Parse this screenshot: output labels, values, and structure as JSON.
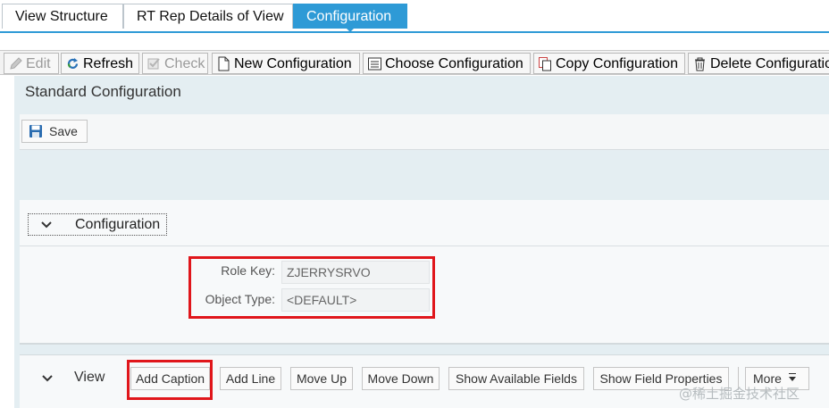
{
  "tabs": [
    {
      "label": "View Structure",
      "active": false
    },
    {
      "label": "RT Rep Details of View",
      "active": false
    },
    {
      "label": "Configuration",
      "active": true
    }
  ],
  "toolbar": {
    "edit": "Edit",
    "refresh": "Refresh",
    "check": "Check",
    "new_configuration": "New Configuration",
    "choose_configuration": "Choose Configuration",
    "copy_configuration": "Copy Configuration",
    "delete_configuration": "Delete Configuratio"
  },
  "panel": {
    "title": "Standard Configuration",
    "save_label": "Save"
  },
  "configuration_section": {
    "title": "Configuration",
    "role_key_label": "Role Key:",
    "role_key_value": "ZJERRYSRVO",
    "object_type_label": "Object Type:",
    "object_type_value": "<DEFAULT>"
  },
  "view_section": {
    "title": "View",
    "buttons": {
      "add_caption": "Add Caption",
      "add_line": "Add Line",
      "move_up": "Move Up",
      "move_down": "Move Down",
      "show_available_fields": "Show Available Fields",
      "show_field_properties": "Show Field Properties",
      "more": "More"
    }
  },
  "watermark": "@稀土掘金技术社区",
  "colors": {
    "accent": "#2e9ad6",
    "highlight": "#e0161b",
    "panel_bg": "#e4eef2"
  }
}
